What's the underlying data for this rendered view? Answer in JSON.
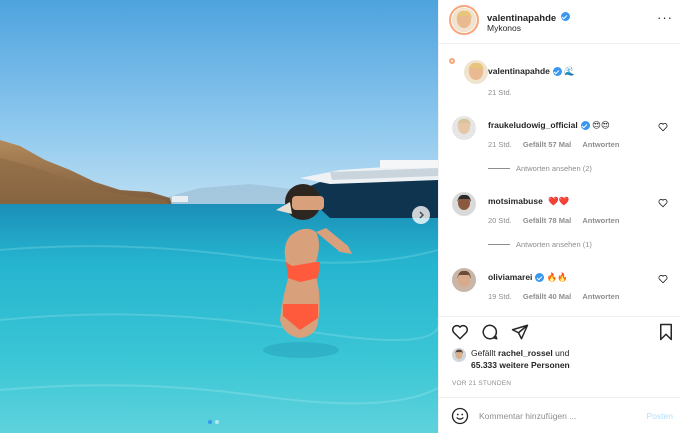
{
  "post": {
    "author": "valentinapahde",
    "location": "Mykonos",
    "caption_emoji": "🌊",
    "caption_time": "21 Std.",
    "next_icon": "chevron-right-icon",
    "more_icon": "more-horizontal-icon"
  },
  "comments": [
    {
      "user": "fraukeludowig_official",
      "text": "😍😍",
      "time": "21 Std.",
      "likes": "Gefällt 57 Mal",
      "reply": "Antworten",
      "view_replies": "Antworten ansehen (2)"
    },
    {
      "user": "motsimabuse",
      "text": "❤️❤️",
      "time": "20 Std.",
      "likes": "Gefällt 78 Mal",
      "reply": "Antworten",
      "view_replies": "Antworten ansehen (1)"
    },
    {
      "user": "oliviamarei",
      "text": "🔥🔥",
      "time": "19 Std.",
      "likes": "Gefällt 40 Mal",
      "reply": "Antworten"
    }
  ],
  "likes": {
    "prefix": "Gefällt",
    "user": "rachel_rossel",
    "connector": "und",
    "count": "65.333 weitere Personen"
  },
  "time_ago": "VOR 21 STUNDEN",
  "comment_input": {
    "placeholder": "Kommentar hinzufügen ...",
    "post_label": "Posten"
  },
  "colors": {
    "verified": "#3897f0",
    "text": "#262626",
    "muted": "#8e8e8e",
    "post_disabled": "#b2dffc",
    "border": "#efefef"
  }
}
